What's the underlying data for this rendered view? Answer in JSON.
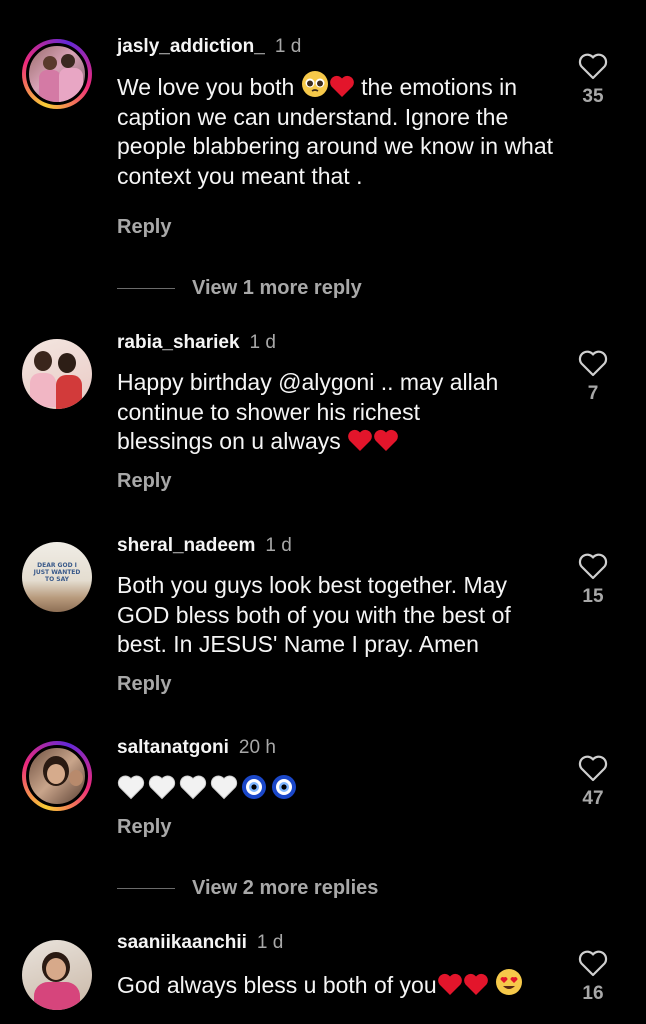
{
  "comments": [
    {
      "username": "jasly_addiction_",
      "time": "1 d",
      "text_part1": "We love you both",
      "text_part2": "the emotions in caption we can understand. Ignore the people blabbering around we know in what context you meant that .",
      "reply_label": "Reply",
      "likes": "35",
      "view_more": "View 1 more reply"
    },
    {
      "username": "rabia_shariek",
      "time": "1 d",
      "text_part1": "Happy birthday @alygoni .. may allah continue to shower his richest blessings on u always",
      "reply_label": "Reply",
      "likes": "7"
    },
    {
      "username": "sheral_nadeem",
      "time": "1 d",
      "text_part1": "Both you guys look best together. May GOD bless both of you with the best of best. In JESUS' Name I pray. Amen",
      "reply_label": "Reply",
      "likes": "15",
      "avatar_text": "DEAR GOD I JUST WANTED TO SAY"
    },
    {
      "username": "saltanatgoni",
      "time": "20 h",
      "reply_label": "Reply",
      "likes": "47",
      "view_more": "View 2 more replies"
    },
    {
      "username": "saaniikaanchii",
      "time": "1 d",
      "text_part1": "God always bless u both of you",
      "likes": "16"
    }
  ],
  "icons": {
    "like": "heart-outline-icon",
    "heart_color": "#e3152b",
    "ring_gradient": [
      "#f9ce34",
      "#ee2a7b",
      "#6228d7"
    ]
  }
}
